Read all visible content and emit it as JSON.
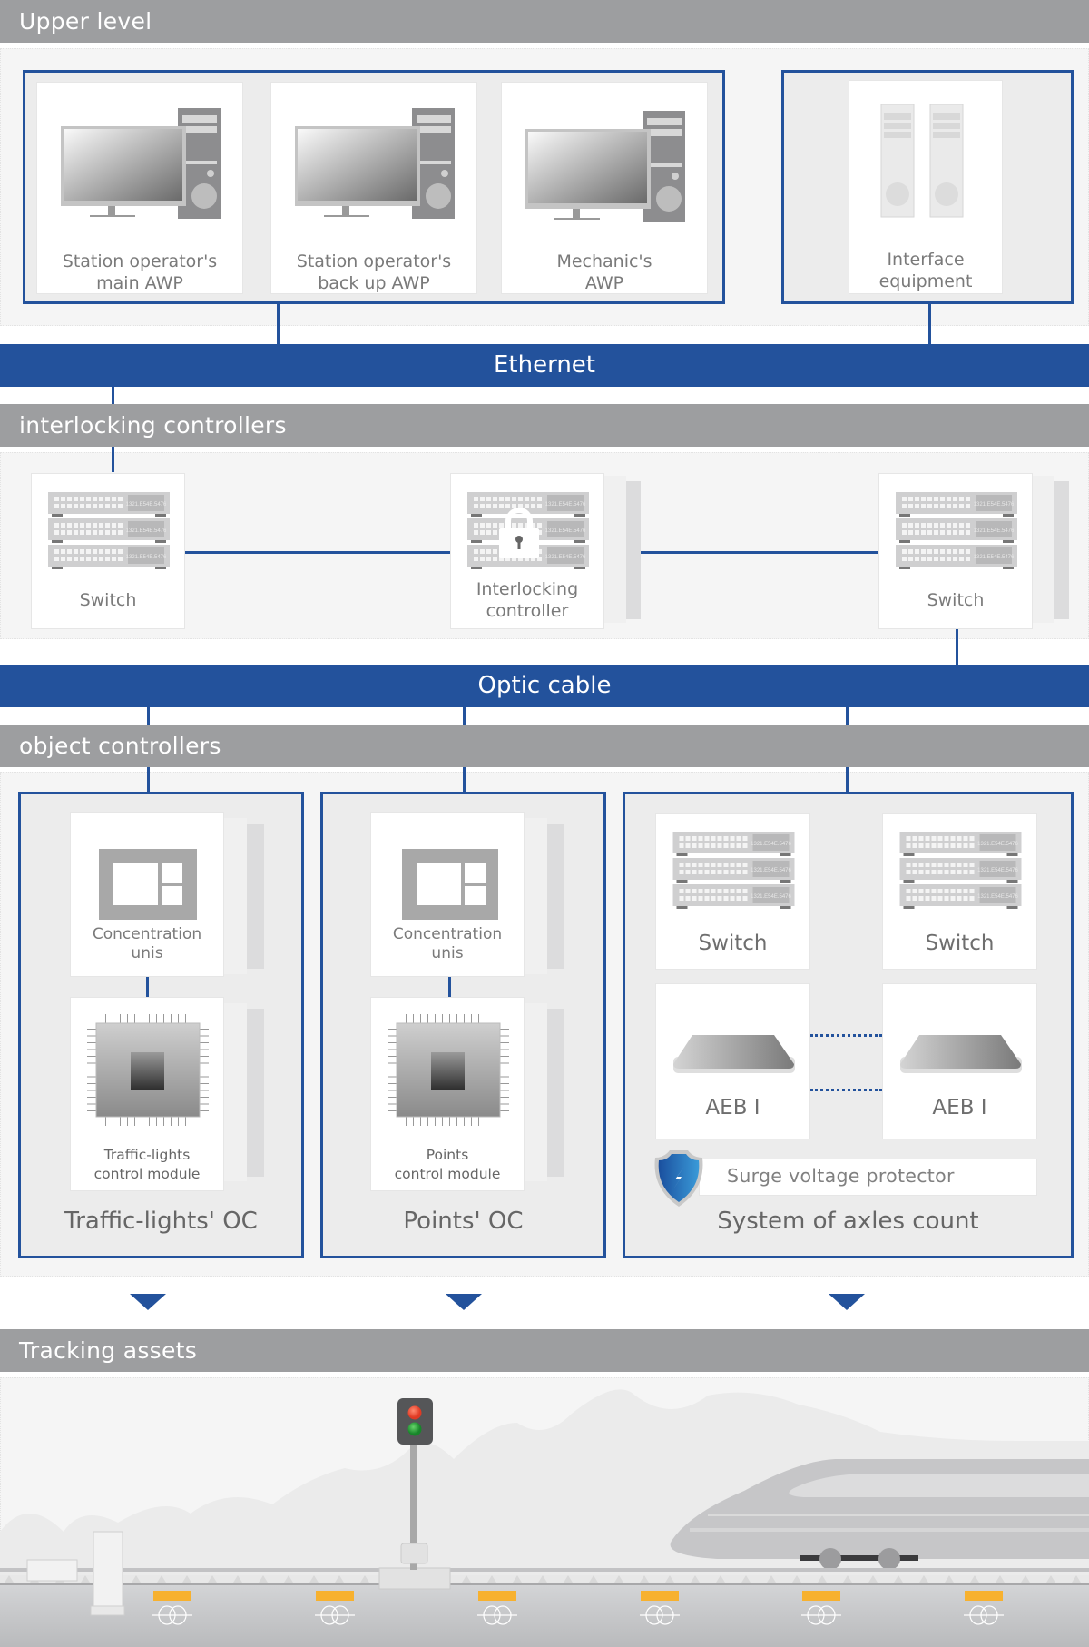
{
  "sections": {
    "upper": "Upper level",
    "interlocking": "interlocking controllers",
    "object": "object controllers",
    "tracking": "Tracking assets"
  },
  "buses": {
    "ethernet": "Ethernet",
    "optic": "Optic cable"
  },
  "upper_level": {
    "workstations": [
      {
        "line1": "Station operator's",
        "line2": "main AWP"
      },
      {
        "line1": "Station operator's",
        "line2": "back up AWP"
      },
      {
        "line1": "Mechanic's",
        "line2": "AWP"
      }
    ],
    "interface": {
      "line1": "Interface",
      "line2": "equipment"
    }
  },
  "interlocking_controllers": {
    "left_switch": "Switch",
    "controller": {
      "line1": "Interlocking",
      "line2": "controller"
    },
    "right_switch": "Switch",
    "switch_panel_text": "1321.E54E.5476"
  },
  "object_controllers": {
    "traffic_lights": {
      "concentration": {
        "line1": "Concentration",
        "line2": "unis"
      },
      "module": {
        "line1": "Traffic-lights",
        "line2": "control module"
      },
      "title": "Traffic-lights' OC"
    },
    "points": {
      "concentration": {
        "line1": "Concentration",
        "line2": "unis"
      },
      "module": {
        "line1": "Points",
        "line2": "control module"
      },
      "title": "Points' OC"
    },
    "axles": {
      "switch_left": "Switch",
      "switch_right": "Switch",
      "aeb_left": "AEB I",
      "aeb_right": "AEB I",
      "surge": "Surge voltage protector",
      "title": "System of axles count"
    }
  },
  "colors": {
    "bus_blue": "#23529c",
    "header_gray": "#9d9ea0",
    "signal_red": "#e8402b",
    "signal_green": "#1f9a2f",
    "sensor_yellow": "#f7b12f"
  }
}
